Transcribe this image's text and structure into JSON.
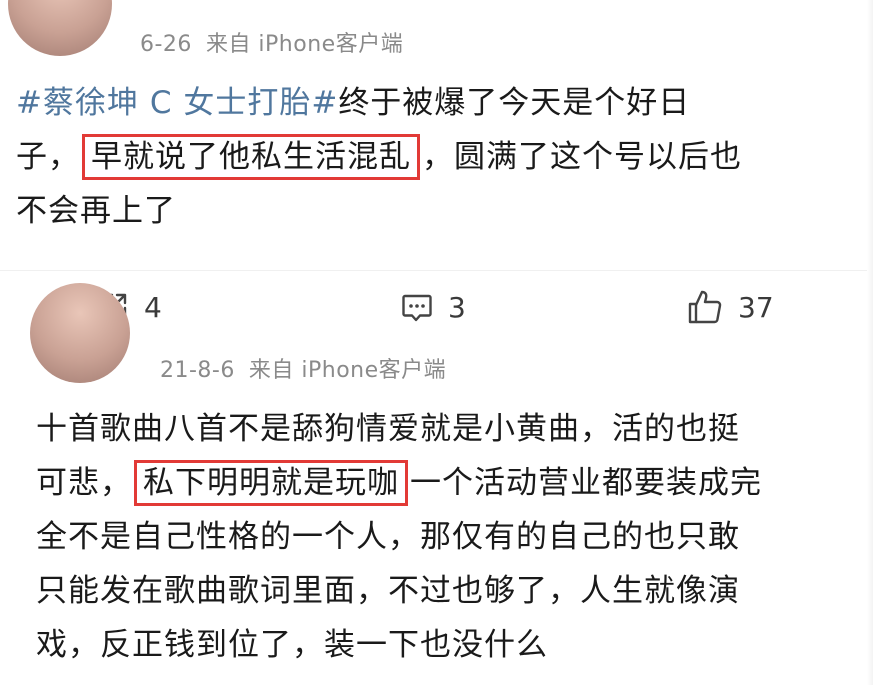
{
  "post": {
    "date": "6-26",
    "source": "来自 iPhone客户端",
    "hashtag": "#蔡徐坤 C 女士打胎#",
    "line1_rest": "终于被爆了今天是个好日",
    "line2_pre": "子，",
    "highlight": "早就说了他私生活混乱",
    "line2_post": "，圆满了这个号以后也",
    "line3": "不会再上了",
    "stats": {
      "reposts": "4",
      "comments": "3",
      "likes": "37"
    }
  },
  "reply": {
    "date": "21-8-6",
    "source": "来自 iPhone客户端",
    "line1": "十首歌曲八首不是舔狗情爱就是小黄曲，活的也挺",
    "line2_pre": "可悲，",
    "highlight": "私下明明就是玩咖",
    "line2_post": "一个活动营业都要装成完",
    "line3": "全不是自己性格的一个人，那仅有的自己的也只敢",
    "line4": "只能发在歌曲歌词里面，不过也够了，人生就像演",
    "line5": "戏，反正钱到位了，装一下也没什么"
  },
  "icons": {
    "repost": "repost-icon",
    "comment": "comment-icon",
    "like": "like-icon"
  },
  "colors": {
    "hashtag": "#50779e",
    "highlight_border": "#e23a36",
    "meta": "#8a8a8a"
  }
}
